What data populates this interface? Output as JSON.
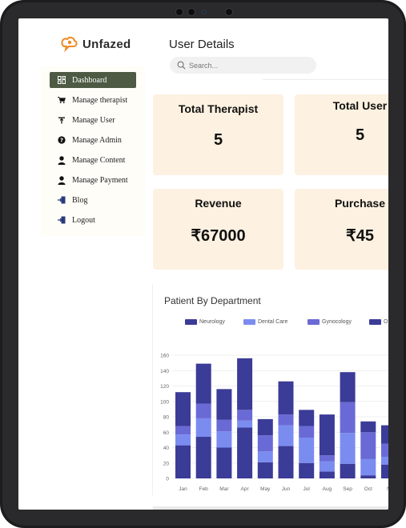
{
  "app": {
    "name": "Unfazed"
  },
  "page": {
    "title": "User Details"
  },
  "search": {
    "placeholder": "Search..."
  },
  "sidebar": {
    "items": [
      {
        "label": "Dashboard",
        "icon": "dashboard-icon",
        "active": true
      },
      {
        "label": "Manage therapist",
        "icon": "cart-icon"
      },
      {
        "label": "Manage User",
        "icon": "user-pin-icon"
      },
      {
        "label": "Manage Admin",
        "icon": "help-icon"
      },
      {
        "label": "Manage Content",
        "icon": "person-icon"
      },
      {
        "label": "Manage Payment",
        "icon": "person-icon"
      },
      {
        "label": "Blog",
        "icon": "exit-icon"
      },
      {
        "label": "Logout",
        "icon": "exit-icon"
      }
    ]
  },
  "cards": [
    {
      "title": "Total Therapist",
      "value": "5"
    },
    {
      "title": "Total User",
      "value": "5"
    },
    {
      "title": "Revenue",
      "value": "₹67000"
    },
    {
      "title": "Purchase",
      "value": "₹45"
    }
  ],
  "colors": {
    "active_nav": "#4e5a44",
    "card_bg": "#fdf1e1",
    "neurology": "#3b3b98",
    "dental_care": "#7b8cf0",
    "gynocology": "#6a6ad6",
    "series4": "#3b3b98"
  },
  "chart_data": {
    "type": "bar",
    "stacked": true,
    "title": "Patient By Department",
    "categories": [
      "Jan",
      "Feb",
      "Mar",
      "Apr",
      "May",
      "Jun",
      "Jul",
      "Aug",
      "Sep",
      "Oct",
      "N"
    ],
    "ylim": [
      0,
      160
    ],
    "yticks": [
      0,
      20,
      40,
      60,
      80,
      100,
      120,
      140,
      160
    ],
    "series": [
      {
        "name": "",
        "values": [
          43,
          54,
          40,
          66,
          21,
          42,
          20,
          9,
          19,
          4,
          18
        ]
      },
      {
        "name": "",
        "values": [
          14,
          24,
          21,
          9,
          14,
          27,
          33,
          13,
          40,
          21,
          10
        ]
      },
      {
        "name": "",
        "values": [
          11,
          19,
          15,
          14,
          21,
          14,
          15,
          8,
          40,
          35,
          17
        ]
      },
      {
        "name": "",
        "values": [
          44,
          52,
          40,
          67,
          21,
          43,
          21,
          53,
          39,
          14,
          24
        ]
      }
    ],
    "legend": {
      "position": "top",
      "entries": [
        "Neurology",
        "Dental Care",
        "Gynocology",
        "O"
      ]
    },
    "grid": true
  }
}
